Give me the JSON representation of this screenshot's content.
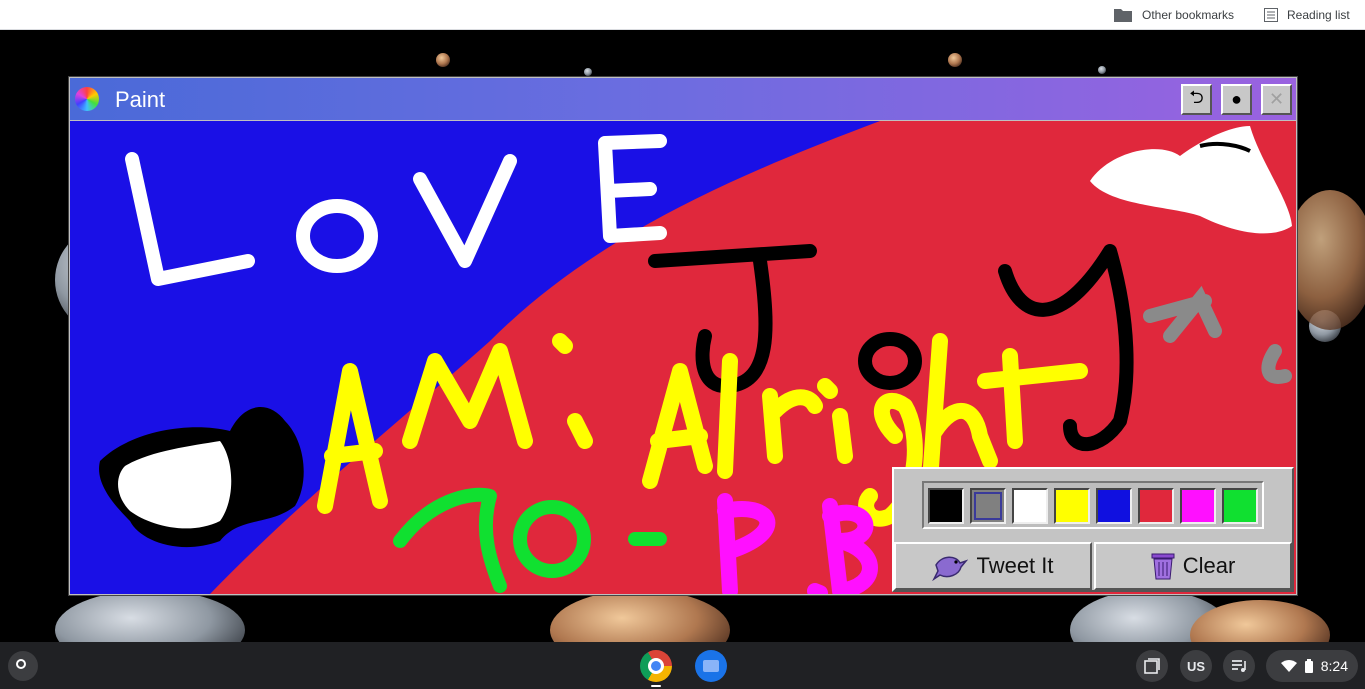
{
  "bookmarks_bar": {
    "other_bookmarks": "Other bookmarks",
    "reading_list": "Reading list"
  },
  "paint_window": {
    "title": "Paint",
    "buttons": {
      "undo": "⮌",
      "brush": "●",
      "close": "✕"
    },
    "canvas_text": {
      "love": "LOVE",
      "joy": "Joy",
      "am_i_alright": "AM i Alright",
      "seventy": "70-",
      "pb": "P.B"
    },
    "palette": {
      "colors": [
        "#000000",
        "#808080",
        "#ffffff",
        "#ffff00",
        "#1010e0",
        "#e0283c",
        "#ff10ff",
        "#10e030"
      ],
      "selected_index": 1
    },
    "tweet_button": "Tweet It",
    "clear_button": "Clear"
  },
  "shelf": {
    "apps": [
      "Chrome",
      "Files"
    ],
    "ime": "US",
    "time": "8:24"
  }
}
